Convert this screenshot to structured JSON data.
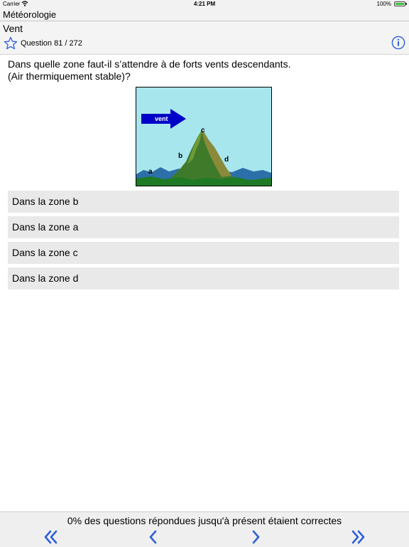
{
  "status_bar": {
    "carrier": "Carrier",
    "time": "4:21 PM",
    "battery": "100%"
  },
  "app": {
    "title": "Météorologie"
  },
  "section": {
    "title": "Vent",
    "counter": "Question 81 / 272"
  },
  "question": {
    "text": "Dans quelle zone faut-il s’attendre à de forts vents descendants. (Air thermiquement stable)?"
  },
  "figure": {
    "arrow_label": "vent",
    "zone_labels": [
      "a",
      "b",
      "c",
      "d"
    ],
    "colors": {
      "sky": "#a8e6ee",
      "arrow": "#0000c8",
      "mountain": "#3e7a2a",
      "ground": "#1f7a25"
    }
  },
  "answers": [
    {
      "label": "Dans la zone b"
    },
    {
      "label": "Dans la zone a"
    },
    {
      "label": "Dans la zone c"
    },
    {
      "label": "Dans la zone d"
    }
  ],
  "footer": {
    "status": "0% des questions répondues jusqu'à présent étaient correctes"
  },
  "colors": {
    "accent": "#2f5fd6",
    "answer_bg": "#e9e9e9"
  }
}
